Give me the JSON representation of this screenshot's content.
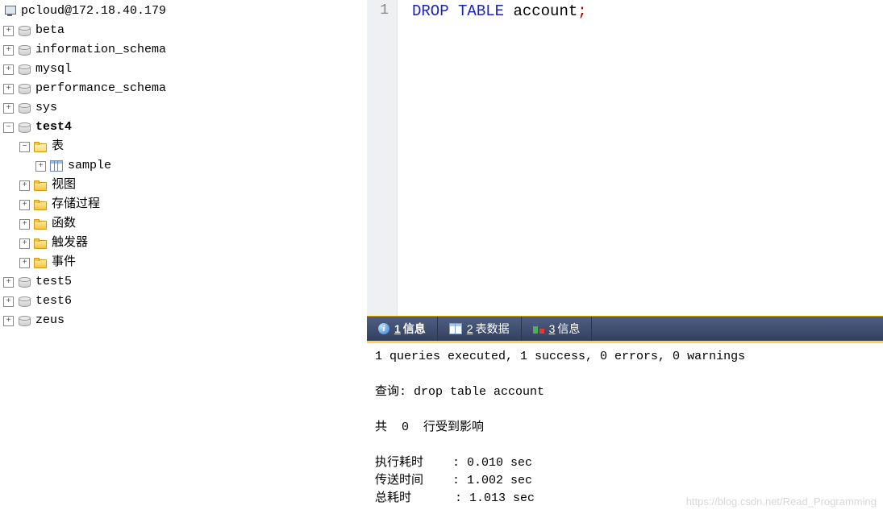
{
  "connection": "pcloud@172.18.40.179",
  "tree": {
    "dbs_collapsed": [
      "beta",
      "information_schema",
      "mysql",
      "performance_schema",
      "sys"
    ],
    "db_expanded": "test4",
    "folders": {
      "tables": "表",
      "views": "视图",
      "procs": "存储过程",
      "funcs": "函数",
      "triggers": "触发器",
      "events": "事件"
    },
    "table_item": "sample",
    "dbs_after": [
      "test5",
      "test6",
      "zeus"
    ]
  },
  "editor": {
    "line_no": "1",
    "kw1": "DROP",
    "kw2": "TABLE",
    "ident": "account",
    "semi": ";"
  },
  "tabs": {
    "t1_num": "1",
    "t1_label": "信息",
    "t2_num": "2",
    "t2_label": "表数据",
    "t3_num": "3",
    "t3_label": "信息"
  },
  "output": {
    "line1": "1 queries executed, 1 success, 0 errors, 0 warnings",
    "line2": "查询: drop table account",
    "line3": "共  0  行受到影响",
    "time1": "执行耗时    : 0.010 sec",
    "time2": "传送时间    : 1.002 sec",
    "time3": "总耗时      : 1.013 sec"
  },
  "watermark": "https://blog.csdn.net/Read_Programming"
}
